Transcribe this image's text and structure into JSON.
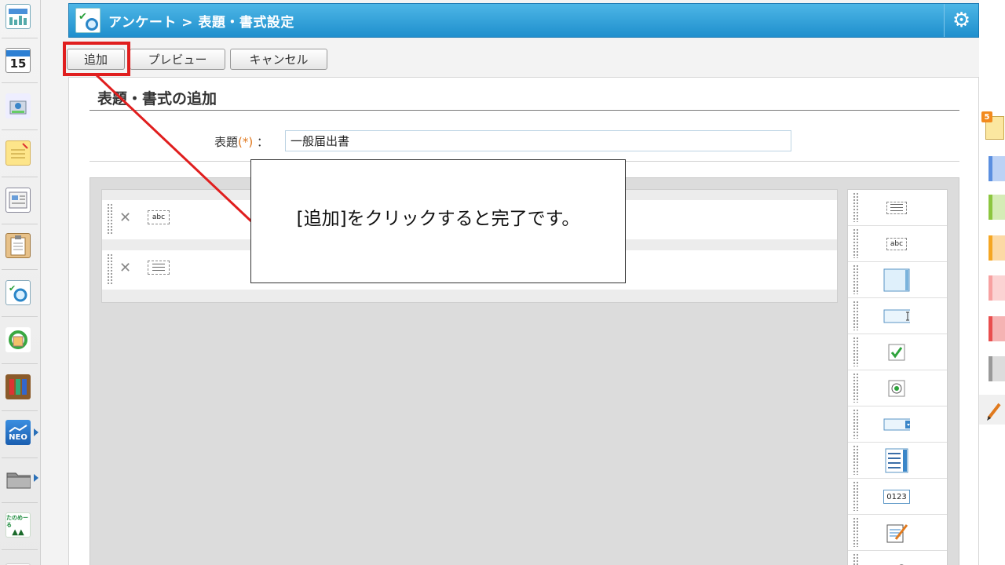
{
  "title_bar": {
    "title": "アンケート > 表題・書式設定",
    "icon": "survey-icon",
    "settings_icon": "gear-icon"
  },
  "toolbar": {
    "add_label": "追加",
    "preview_label": "プレビュー",
    "cancel_label": "キャンセル"
  },
  "panel": {
    "title": "表題・書式の追加",
    "subject_label": "表題",
    "required_mark": "(*)",
    "label_colon": "：",
    "subject_value": "一般届出書"
  },
  "fields": [
    {
      "icon": "textbox-field-icon",
      "icon_text": "abc",
      "delete_icon": "close-icon"
    },
    {
      "icon": "label-field-icon",
      "icon_text": "",
      "delete_icon": "close-icon"
    }
  ],
  "palette": [
    {
      "icon": "label-part-icon",
      "text": ""
    },
    {
      "icon": "textbox-part-icon",
      "text": "abc"
    },
    {
      "icon": "textarea-part-icon",
      "text": ""
    },
    {
      "icon": "single-line-input-icon",
      "text": ""
    },
    {
      "icon": "checkbox-part-icon",
      "text": ""
    },
    {
      "icon": "radio-part-icon",
      "text": ""
    },
    {
      "icon": "dropdown-part-icon",
      "text": ""
    },
    {
      "icon": "listbox-part-icon",
      "text": ""
    },
    {
      "icon": "number-part-icon",
      "text": "0123"
    },
    {
      "icon": "memo-part-icon",
      "text": ""
    },
    {
      "icon": "attachment-part-icon",
      "text": ""
    }
  ],
  "left_dock": [
    "portal-icon",
    "calendar-icon",
    "facility-icon",
    "memo-icon",
    "bulletin-icon",
    "clipboard-icon",
    "survey-icon",
    "refresh-icon",
    "cabinet-icon",
    "neo-icon",
    "folder-icon",
    "tanomail-icon",
    "app-icon"
  ],
  "calendar_day": "15",
  "dock_labels": {
    "neo": "NEO",
    "tanomail": "たのめーる"
  },
  "right_dock": {
    "badge": "5",
    "tab_colors": [
      "#5b8fe0",
      "#8cc63f",
      "#f5a623",
      "#f7a1a1",
      "#e94e4e",
      "#999999"
    ],
    "pencil_icon": "pencil-icon"
  },
  "callout": {
    "text": "[追加]をクリックすると完了です。"
  }
}
